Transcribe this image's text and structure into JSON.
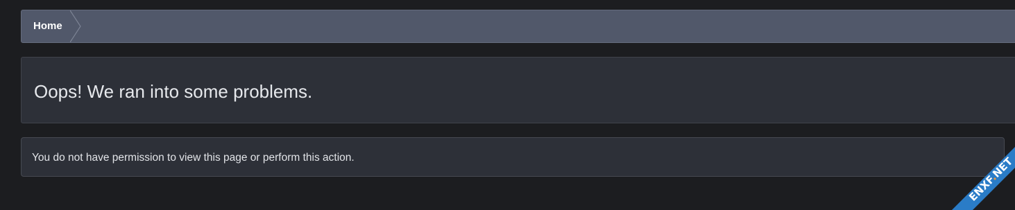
{
  "breadcrumb": {
    "items": [
      {
        "label": "Home"
      }
    ]
  },
  "error": {
    "title": "Oops! We ran into some problems.",
    "message": "You do not have permission to view this page or perform this action."
  },
  "watermark": {
    "text": "ENXF.NET"
  },
  "colors": {
    "background": "#1c1d20",
    "breadcrumb_bg": "#51586a",
    "panel_bg": "#2d3038",
    "watermark_blue": "#1f6fb3",
    "watermark_orange": "#f07a1c"
  }
}
